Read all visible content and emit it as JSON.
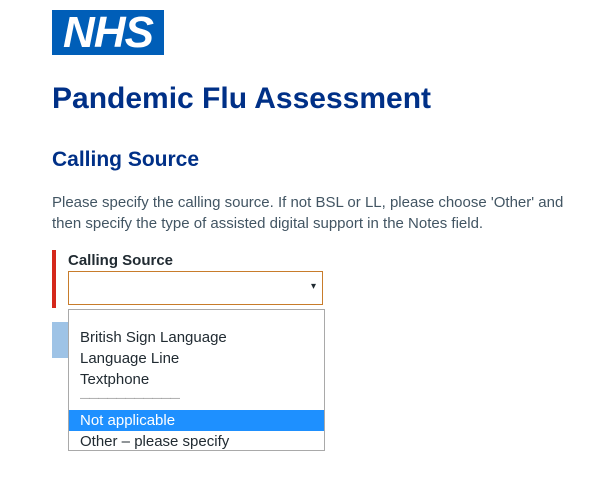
{
  "logo": {
    "text": "NHS"
  },
  "page_title": "Pandemic Flu Assessment",
  "section_title": "Calling Source",
  "intro": "Please specify the calling source. If not BSL or LL, please choose 'Other' and then specify the type of assisted digital support in the Notes field.",
  "field": {
    "label": "Calling Source",
    "selected_value": "",
    "arrow": "▾"
  },
  "dropdown": {
    "options": [
      {
        "label": "British Sign Language"
      },
      {
        "label": "Language Line"
      },
      {
        "label": "Textphone"
      },
      {
        "label": "———————————"
      },
      {
        "label": "Not applicable",
        "highlighted": true
      },
      {
        "label": "Other – please specify"
      }
    ]
  },
  "colors": {
    "brand_blue": "#005eb8",
    "heading_blue": "#003087",
    "error_red": "#d5281b",
    "highlight_blue": "#1e90ff"
  }
}
